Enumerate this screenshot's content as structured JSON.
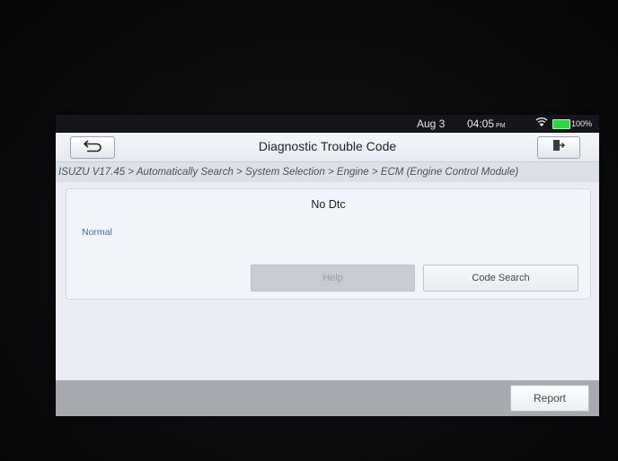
{
  "status_bar": {
    "date": "Aug 3",
    "time": "04:05",
    "ampm": "PM",
    "battery_percent": "100%",
    "wifi_icon": "wifi-icon",
    "battery_icon": "battery-icon",
    "battery_color": "#2bd63f"
  },
  "header": {
    "title": "Diagnostic Trouble Code",
    "back_icon": "back-arrow-icon",
    "exit_icon": "exit-door-icon"
  },
  "breadcrumb": "ISUZU V17.45 > Automatically Search > System Selection > Engine > ECM (Engine Control Module)",
  "result": {
    "message": "No Dtc",
    "status": "Normal",
    "status_color": "#2d6fd6"
  },
  "buttons": {
    "help": "Help",
    "code_search": "Code Search",
    "report": "Report"
  }
}
